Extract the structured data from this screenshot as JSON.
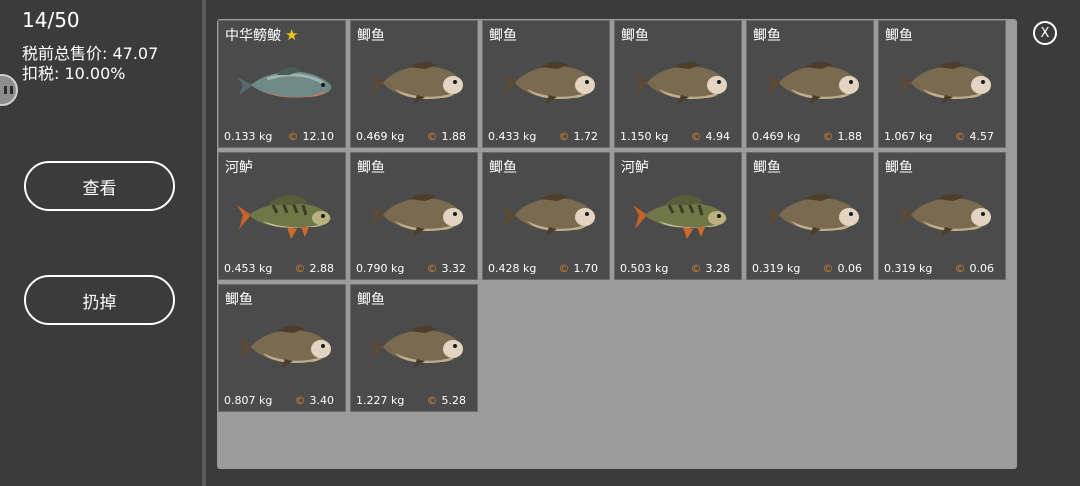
{
  "status": {
    "count": "14/50",
    "pre_tax_total": "税前总售价: 47.07",
    "tax": "扣税: 10.00%"
  },
  "actions": {
    "view_label": "查看",
    "drop_label": "扔掉"
  },
  "close_label": "X",
  "fish": [
    {
      "name": "中华鳑鲏",
      "star": "★",
      "type": "bitterling",
      "weight": "0.133 kg",
      "coin": "©",
      "price": "12.10"
    },
    {
      "name": "鲫鱼",
      "type": "carp",
      "weight": "0.469 kg",
      "coin": "©",
      "price": "1.88"
    },
    {
      "name": "鲫鱼",
      "type": "carp",
      "weight": "0.433 kg",
      "coin": "©",
      "price": "1.72"
    },
    {
      "name": "鲫鱼",
      "type": "carp",
      "weight": "1.150 kg",
      "coin": "©",
      "price": "4.94"
    },
    {
      "name": "鲫鱼",
      "type": "carp",
      "weight": "0.469 kg",
      "coin": "©",
      "price": "1.88"
    },
    {
      "name": "鲫鱼",
      "type": "carp",
      "weight": "1.067 kg",
      "coin": "©",
      "price": "4.57"
    },
    {
      "name": "河鲈",
      "type": "perch",
      "weight": "0.453 kg",
      "coin": "©",
      "price": "2.88"
    },
    {
      "name": "鲫鱼",
      "type": "carp",
      "weight": "0.790 kg",
      "coin": "©",
      "price": "3.32"
    },
    {
      "name": "鲫鱼",
      "type": "carp",
      "weight": "0.428 kg",
      "coin": "©",
      "price": "1.70"
    },
    {
      "name": "河鲈",
      "type": "perch",
      "weight": "0.503 kg",
      "coin": "©",
      "price": "3.28"
    },
    {
      "name": "鲫鱼",
      "type": "carp",
      "weight": "0.319 kg",
      "coin": "©",
      "price": "0.06"
    },
    {
      "name": "鲫鱼",
      "type": "carp",
      "weight": "0.319 kg",
      "coin": "©",
      "price": "0.06"
    },
    {
      "name": "鲫鱼",
      "type": "carp",
      "weight": "0.807 kg",
      "coin": "©",
      "price": "3.40"
    },
    {
      "name": "鲫鱼",
      "type": "carp",
      "weight": "1.227 kg",
      "coin": "©",
      "price": "5.28"
    }
  ]
}
